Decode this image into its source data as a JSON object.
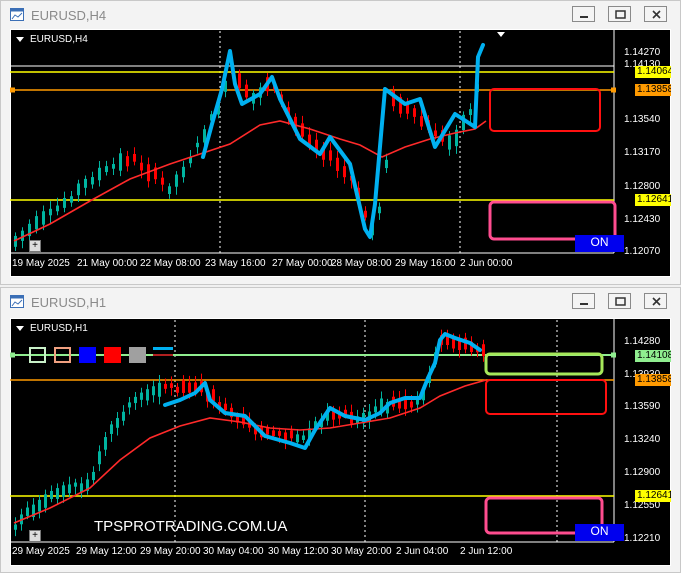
{
  "colors": {
    "bull": "#00b4a0",
    "bear": "#ff0000",
    "trend": "#00b0f0",
    "ma": "#ff2a2a",
    "yellow_level": "#ffff00",
    "orange_level": "#ff9a00",
    "green_level": "#90ee90",
    "on_button": "#0000ee"
  },
  "windows": [
    {
      "title": "EURUSD,H4",
      "symbol_label": "EURUSD,H4",
      "on_label": "ON",
      "price_labels": [
        "1.14270",
        "1.14130",
        "1.13540",
        "1.13170",
        "1.12800",
        "1.12430",
        "1.12070"
      ],
      "level_badges": [
        {
          "value": "1.14064",
          "color": "yellow"
        },
        {
          "value": "1.13858",
          "color": "orange"
        },
        {
          "value": "1.12641",
          "color": "yellow"
        }
      ],
      "time_labels": [
        "19 May 2025",
        "21 May 00:00",
        "22 May 08:00",
        "23 May 16:00",
        "27 May 00:00",
        "28 May 08:00",
        "29 May 16:00",
        "2 Jun 00:00"
      ]
    },
    {
      "title": "EURUSD,H1",
      "symbol_label": "EURUSD,H1",
      "on_label": "ON",
      "watermark": "TPSPROTRADING.COM.UA",
      "price_labels": [
        "1.14280",
        "1.13930",
        "1.13590",
        "1.13240",
        "1.12900",
        "1.12550",
        "1.12210"
      ],
      "level_badges": [
        {
          "value": "1.14108",
          "color": "green"
        },
        {
          "value": "1.13858",
          "color": "orange"
        },
        {
          "value": "1.12641",
          "color": "yellow"
        }
      ],
      "time_labels": [
        "29 May 2025",
        "29 May 12:00",
        "29 May 20:00",
        "30 May 04:00",
        "30 May 12:00",
        "30 May 20:00",
        "2 Jun 04:00",
        "2 Jun 12:00"
      ],
      "toolbar_swatches": [
        "green-outline",
        "orange-outline",
        "blue",
        "red",
        "gray"
      ]
    }
  ]
}
